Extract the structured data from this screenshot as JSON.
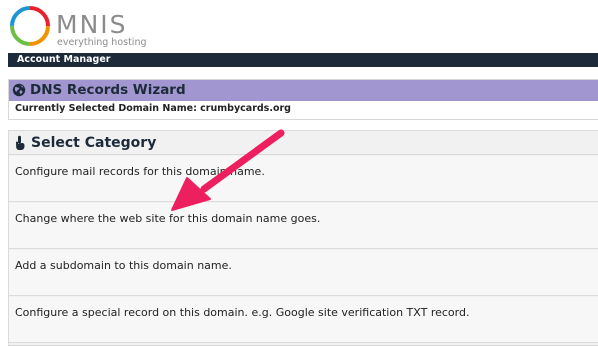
{
  "brand": {
    "name": "MNIS",
    "tagline": "everything hosting"
  },
  "account_bar": {
    "label": "Account Manager"
  },
  "wizard": {
    "title": "DNS Records Wizard",
    "domain_line": "Currently Selected Domain Name: crumbycards.org"
  },
  "category": {
    "title": "Select Category",
    "items": [
      {
        "label": "Configure mail records for this domain name."
      },
      {
        "label": "Change where the web site for this domain name goes."
      },
      {
        "label": "Add a subdomain to this domain name."
      },
      {
        "label": "Configure a special record on this domain. e.g. Google site verification TXT record."
      }
    ]
  },
  "colors": {
    "account_bar_bg": "#1d2a3a",
    "wizard_header_bg": "#a196cf",
    "arrow": "#ee1f5e",
    "logo_ring": [
      "#e8212e",
      "#f39200",
      "#1c95d2",
      "#6cbf45"
    ]
  },
  "icons": {
    "wizard": "globe-icon",
    "category": "pointing-hand-icon",
    "annotation": "arrow-annotation"
  }
}
